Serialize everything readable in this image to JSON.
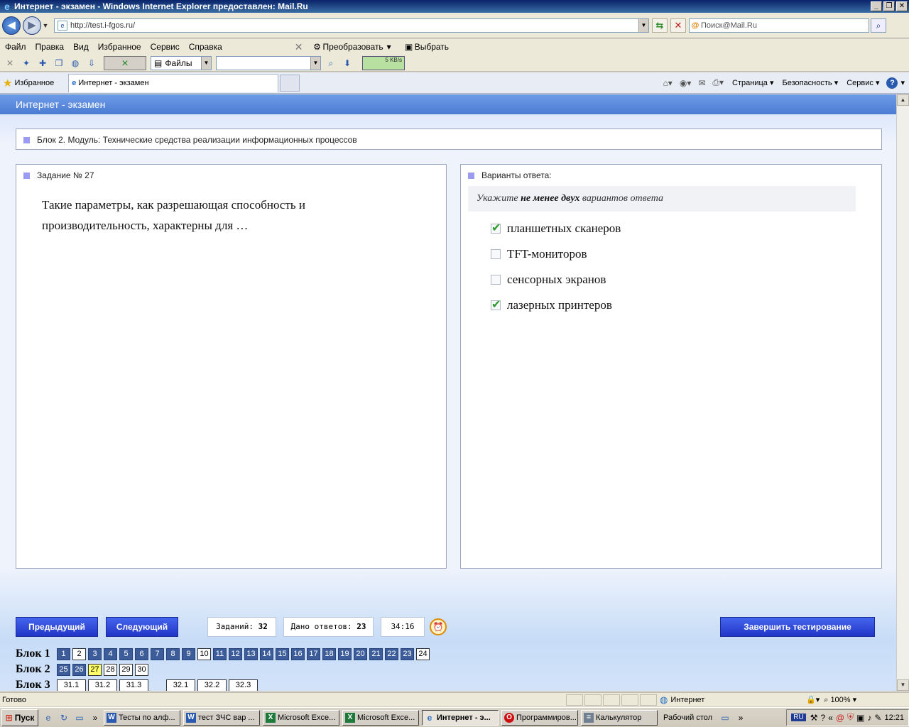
{
  "window": {
    "title": "Интернет - экзамен - Windows Internet Explorer предоставлен: Mail.Ru",
    "buttons": [
      "_",
      "❐",
      "✕"
    ]
  },
  "address": {
    "url": "http://test.i-fgos.ru/",
    "search_placeholder": "Поиск@Mail.Ru"
  },
  "menu": {
    "items": [
      "Файл",
      "Правка",
      "Вид",
      "Избранное",
      "Сервис",
      "Справка"
    ],
    "convert": "Преобразовать",
    "select": "Выбрать"
  },
  "toolbar": {
    "files_label": "Файлы",
    "speed": "5 KB/s"
  },
  "tabs": {
    "favorites": "Избранное",
    "active_tab": "Интернет - экзамен",
    "commands": [
      "Страница",
      "Безопасность",
      "Сервис"
    ]
  },
  "page": {
    "header": "Интернет - экзамен",
    "block_title": "Блок 2. Модуль: Технические средства реализации информационных процессов",
    "task_title": "Задание № 27",
    "question": "Такие параметры, как разрешающая способность и производительность, характерны для …",
    "answers_title": "Варианты ответа:",
    "instruction_pre": "Укажите",
    "instruction_bold": "не менее двух",
    "instruction_post": "вариантов ответа",
    "options": [
      {
        "label": "планшетных сканеров",
        "checked": true
      },
      {
        "label": "TFT-мониторов",
        "checked": false
      },
      {
        "label": "сенсорных экранов",
        "checked": false
      },
      {
        "label": "лазерных принтеров",
        "checked": true
      }
    ]
  },
  "footer": {
    "prev": "Предыдущий",
    "next": "Следующий",
    "finish": "Завершить тестирование",
    "tasks_label": "Заданий:",
    "tasks_count": "32",
    "answers_label": "Дано ответов:",
    "answers_count": "23",
    "timer": "34:16",
    "blocks": [
      {
        "label": "Блок 1",
        "items": [
          {
            "n": "1",
            "s": "answered"
          },
          {
            "n": "2",
            "s": "empty"
          },
          {
            "n": "3",
            "s": "answered"
          },
          {
            "n": "4",
            "s": "answered"
          },
          {
            "n": "5",
            "s": "answered"
          },
          {
            "n": "6",
            "s": "answered"
          },
          {
            "n": "7",
            "s": "answered"
          },
          {
            "n": "8",
            "s": "answered"
          },
          {
            "n": "9",
            "s": "answered"
          },
          {
            "n": "10",
            "s": "empty"
          },
          {
            "n": "11",
            "s": "answered"
          },
          {
            "n": "12",
            "s": "answered"
          },
          {
            "n": "13",
            "s": "answered"
          },
          {
            "n": "14",
            "s": "answered"
          },
          {
            "n": "15",
            "s": "answered"
          },
          {
            "n": "16",
            "s": "answered"
          },
          {
            "n": "17",
            "s": "answered"
          },
          {
            "n": "18",
            "s": "answered"
          },
          {
            "n": "19",
            "s": "answered"
          },
          {
            "n": "20",
            "s": "answered"
          },
          {
            "n": "21",
            "s": "answered"
          },
          {
            "n": "22",
            "s": "answered"
          },
          {
            "n": "23",
            "s": "answered"
          },
          {
            "n": "24",
            "s": "empty"
          }
        ]
      },
      {
        "label": "Блок 2",
        "items": [
          {
            "n": "25",
            "s": "answered"
          },
          {
            "n": "26",
            "s": "answered"
          },
          {
            "n": "27",
            "s": "current"
          },
          {
            "n": "28",
            "s": "empty"
          },
          {
            "n": "29",
            "s": "empty"
          },
          {
            "n": "30",
            "s": "empty"
          }
        ]
      },
      {
        "label": "Блок 3",
        "items": [
          {
            "n": "31.1",
            "s": "empty"
          },
          {
            "n": "31.2",
            "s": "empty"
          },
          {
            "n": "31.3",
            "s": "empty"
          },
          {
            "n": "",
            "s": "gap"
          },
          {
            "n": "32.1",
            "s": "empty"
          },
          {
            "n": "32.2",
            "s": "empty"
          },
          {
            "n": "32.3",
            "s": "empty"
          }
        ]
      }
    ]
  },
  "status": {
    "text": "Готово",
    "zone": "Интернет",
    "zoom": "100%"
  },
  "taskbar": {
    "start": "Пуск",
    "tasks": [
      {
        "label": "Тесты по алф...",
        "icon": "W",
        "kind": ""
      },
      {
        "label": "тест ЗЧС вар ...",
        "icon": "W",
        "kind": ""
      },
      {
        "label": "Microsoft Exce...",
        "icon": "X",
        "kind": "xl"
      },
      {
        "label": "Microsoft Exce...",
        "icon": "X",
        "kind": "xl"
      },
      {
        "label": "Интернет - э...",
        "icon": "e",
        "kind": "ie",
        "active": true
      },
      {
        "label": "Программиров...",
        "icon": "O",
        "kind": "op"
      },
      {
        "label": "Калькулятор",
        "icon": "=",
        "kind": "calc"
      }
    ],
    "desktop": "Рабочий стол",
    "lang": "RU",
    "time": "12:21"
  },
  "colors": {
    "header_blue": "#4b7bd3",
    "button_blue": "#2235c7",
    "answered": "#3d5c9a",
    "current": "#ffff66",
    "check_green": "#2f9a2f"
  }
}
